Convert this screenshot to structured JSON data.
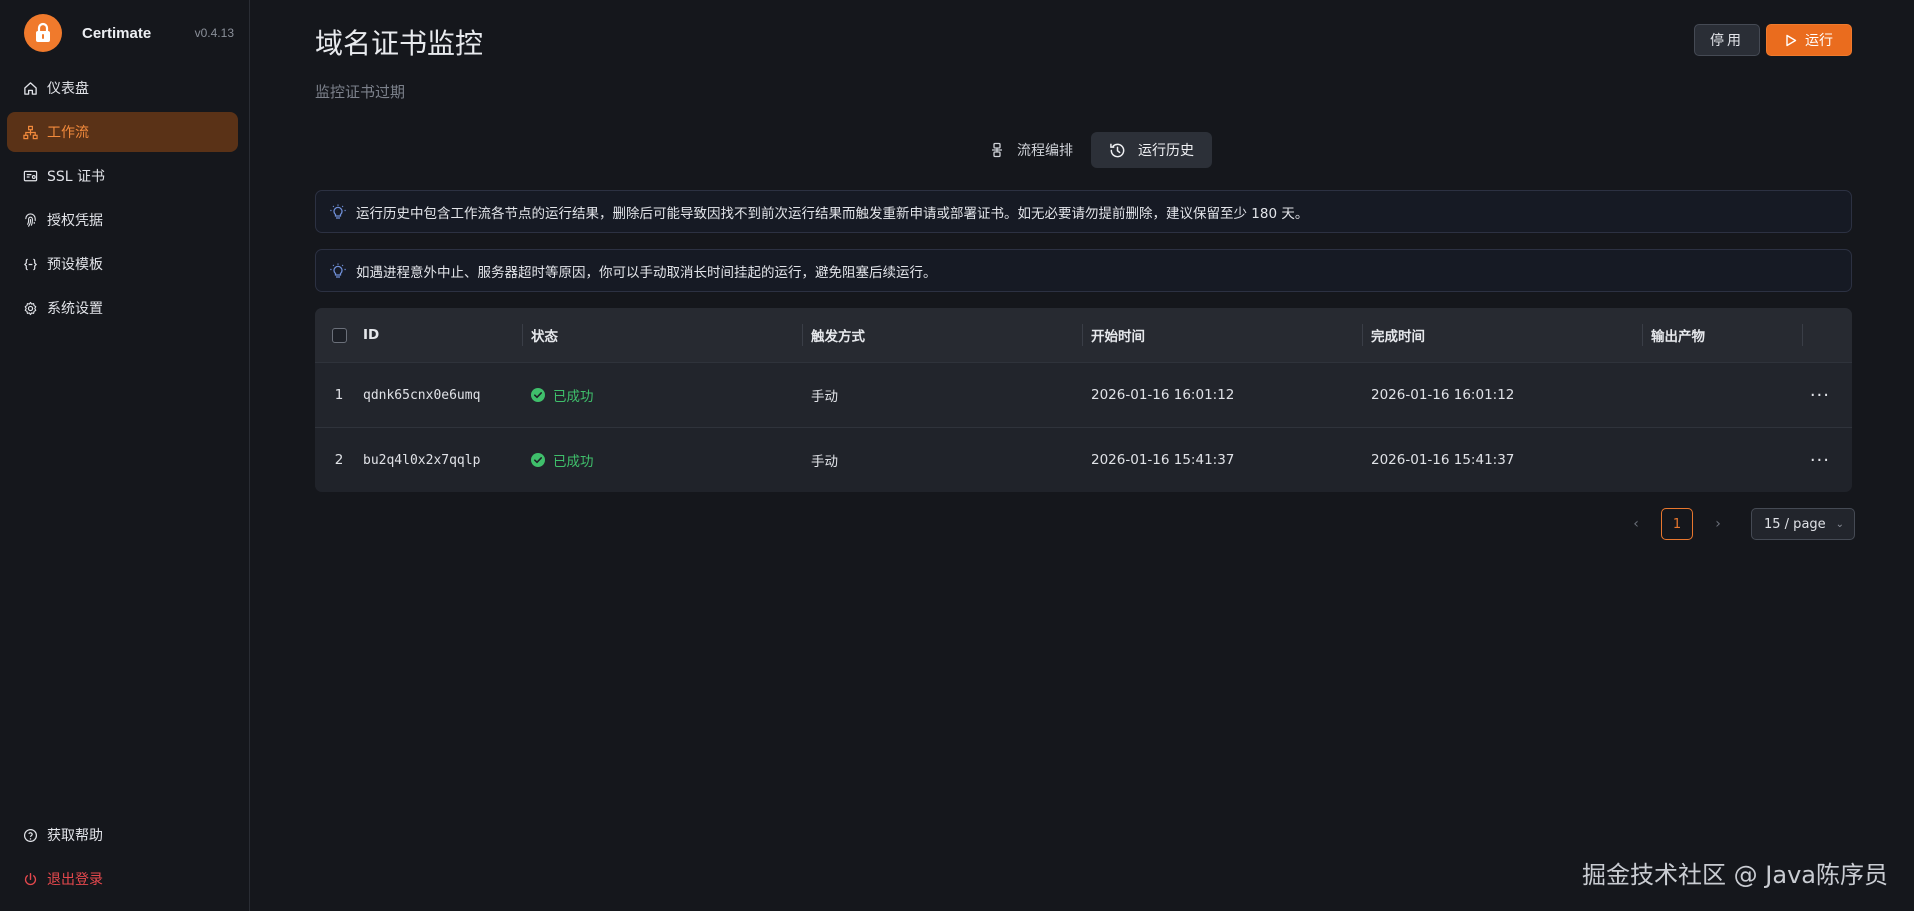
{
  "brand": {
    "name": "Certimate",
    "version": "v0.4.13"
  },
  "sidebar": {
    "items": [
      {
        "label": "仪表盘",
        "icon": "home-icon"
      },
      {
        "label": "工作流",
        "icon": "workflow-icon",
        "active": true
      },
      {
        "label": "SSL 证书",
        "icon": "certificate-icon"
      },
      {
        "label": "授权凭据",
        "icon": "fingerprint-icon"
      },
      {
        "label": "预设模板",
        "icon": "braces-icon"
      },
      {
        "label": "系统设置",
        "icon": "gear-icon"
      }
    ],
    "bottom": [
      {
        "label": "获取帮助",
        "icon": "help-icon"
      },
      {
        "label": "退出登录",
        "icon": "power-icon"
      }
    ]
  },
  "page": {
    "title": "域名证书监控",
    "subtitle": "监控证书过期",
    "stop_label": "停用",
    "run_label": "运行"
  },
  "tabs": [
    {
      "label": "流程编排",
      "icon": "flow-icon"
    },
    {
      "label": "运行历史",
      "icon": "history-icon",
      "active": true
    }
  ],
  "alerts": [
    "运行历史中包含工作流各节点的运行结果，删除后可能导致因找不到前次运行结果而触发重新申请或部署证书。如无必要请勿提前删除，建议保留至少 180 天。",
    "如遇进程意外中止、服务器超时等原因，你可以手动取消长时间挂起的运行，避免阻塞后续运行。"
  ],
  "table": {
    "headers": {
      "id": "ID",
      "status": "状态",
      "trigger": "触发方式",
      "start": "开始时间",
      "end": "完成时间",
      "output": "输出产物"
    },
    "rows": [
      {
        "index": "1",
        "id": "qdnk65cnx0e6umq",
        "status": "已成功",
        "trigger": "手动",
        "start": "2026-01-16 16:01:12",
        "end": "2026-01-16 16:01:12"
      },
      {
        "index": "2",
        "id": "bu2q4l0x2x7qqlp",
        "status": "已成功",
        "trigger": "手动",
        "start": "2026-01-16 15:41:37",
        "end": "2026-01-16 15:41:37"
      }
    ]
  },
  "pagination": {
    "current": "1",
    "page_size": "15 / page"
  },
  "watermark": "掘金技术社区 @ Java陈序员",
  "colors": {
    "accent": "#ea6c1e",
    "success": "#3fbf6b",
    "danger": "#e5484d"
  }
}
